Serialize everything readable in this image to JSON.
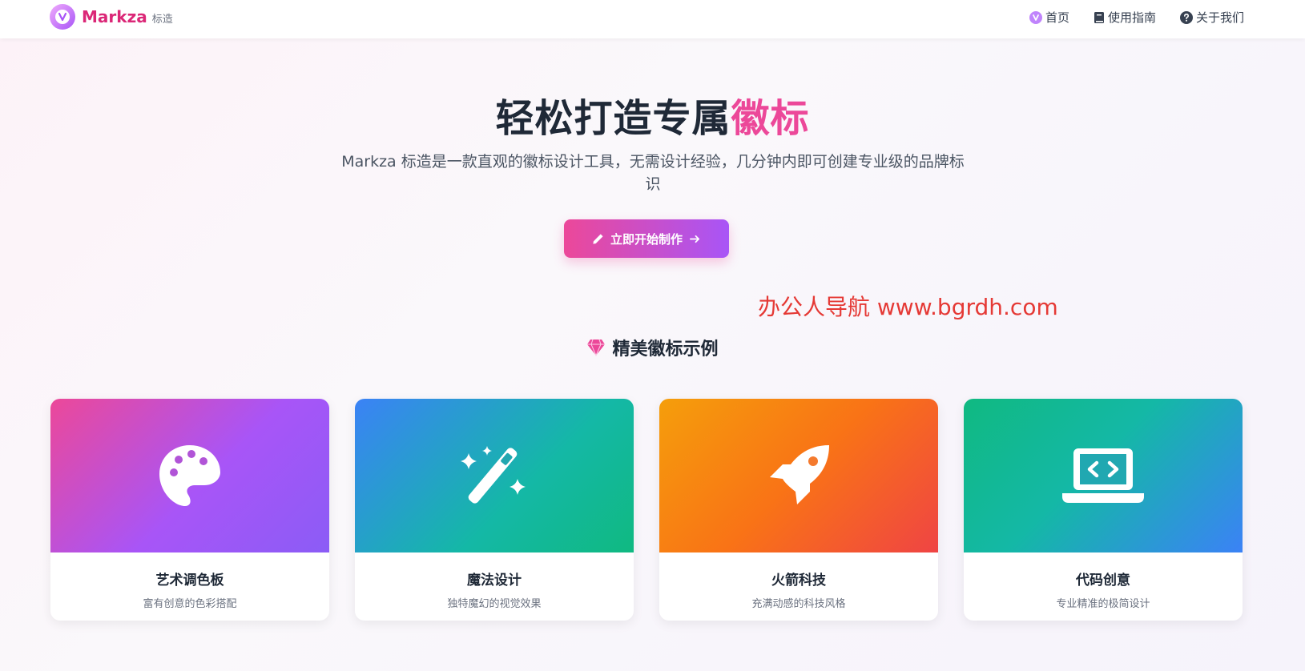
{
  "brand": {
    "name": "Markza",
    "sub": "标造"
  },
  "nav": {
    "items": [
      {
        "label": "首页",
        "icon": "home-logo-icon"
      },
      {
        "label": "使用指南",
        "icon": "book-icon"
      },
      {
        "label": "关于我们",
        "icon": "question-circle-icon"
      }
    ]
  },
  "hero": {
    "title_main": "轻松打造专属",
    "title_accent": "徽标",
    "description": "Markza 标造是一款直观的徽标设计工具，无需设计经验，几分钟内即可创建专业级的品牌标识",
    "cta_label": "立即开始制作"
  },
  "watermark": "办公人导航  www.bgrdh.com",
  "showcase": {
    "title": "精美徽标示例",
    "cards": [
      {
        "title": "艺术调色板",
        "desc": "富有创意的色彩搭配",
        "icon": "palette-icon"
      },
      {
        "title": "魔法设计",
        "desc": "独特魔幻的视觉效果",
        "icon": "magic-wand-icon"
      },
      {
        "title": "火箭科技",
        "desc": "充满动感的科技风格",
        "icon": "rocket-icon"
      },
      {
        "title": "代码创意",
        "desc": "专业精准的极简设计",
        "icon": "laptop-code-icon"
      }
    ]
  },
  "colors": {
    "accent_pink": "#ec4899",
    "accent_purple": "#a855f7",
    "brand": "#db2777"
  }
}
